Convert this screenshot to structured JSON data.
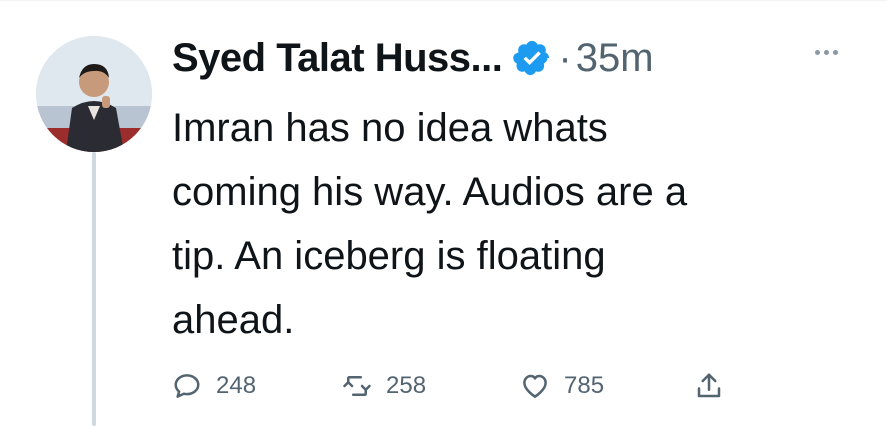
{
  "tweet": {
    "author_name": "Syed Talat Huss...",
    "verified_icon": "verified-badge-icon",
    "separator": "·",
    "timestamp": "35m",
    "text": "Imran has no idea whats\ncoming his way. Audios are a\ntip. An iceberg is floating\nahead.",
    "more_icon": "more-options-icon"
  },
  "actions": {
    "reply": {
      "icon": "reply-icon",
      "count": "248"
    },
    "retweet": {
      "icon": "retweet-icon",
      "count": "258"
    },
    "like": {
      "icon": "like-icon",
      "count": "785"
    },
    "share": {
      "icon": "share-icon"
    }
  },
  "colors": {
    "text": "#0f1419",
    "secondary": "#536471",
    "verified": "#1d9bf0",
    "thread_line": "#cfd9de"
  }
}
